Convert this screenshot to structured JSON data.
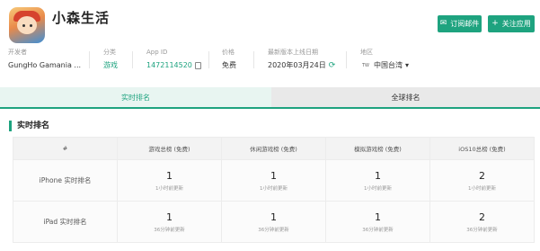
{
  "app": {
    "title": "小森生活",
    "icon": "app-icon-character"
  },
  "buttons": {
    "subscribe": {
      "icon": "mail-icon",
      "label": "订阅邮件"
    },
    "follow": {
      "icon": "plus-icon",
      "label": "关注应用"
    }
  },
  "meta": {
    "developer_label": "开发者",
    "developer_value": "GungHo Gamania ...",
    "category_label": "分类",
    "category_value": "游戏",
    "appid_label": "App ID",
    "appid_value": "1472114520",
    "price_label": "价格",
    "price_value": "免费",
    "date_label": "最新版本上线日期",
    "date_value": "2020年03月24日",
    "region_label": "地区",
    "region_flag": "TW",
    "region_value": "中国台湾",
    "accent_color": "#1ea37f"
  },
  "tabs": [
    {
      "label": "实时排名",
      "active": true
    },
    {
      "label": "全球排名",
      "active": false
    }
  ],
  "section_title": "实时排名",
  "table": {
    "headers": [
      "#",
      "游戏总榜 (免费)",
      "休闲游戏榜 (免费)",
      "模拟游戏榜 (免费)",
      "iOS10总榜 (免费)"
    ],
    "rows": [
      {
        "label": "iPhone 实时排名",
        "cells": [
          {
            "rank": "1",
            "updated": "1小时前更新"
          },
          {
            "rank": "1",
            "updated": "1小时前更新"
          },
          {
            "rank": "1",
            "updated": "1小时前更新"
          },
          {
            "rank": "2",
            "updated": "1小时前更新"
          }
        ]
      },
      {
        "label": "iPad 实时排名",
        "cells": [
          {
            "rank": "1",
            "updated": "36分钟前更新"
          },
          {
            "rank": "1",
            "updated": "36分钟前更新"
          },
          {
            "rank": "1",
            "updated": "36分钟前更新"
          },
          {
            "rank": "2",
            "updated": "36分钟前更新"
          }
        ]
      }
    ]
  }
}
